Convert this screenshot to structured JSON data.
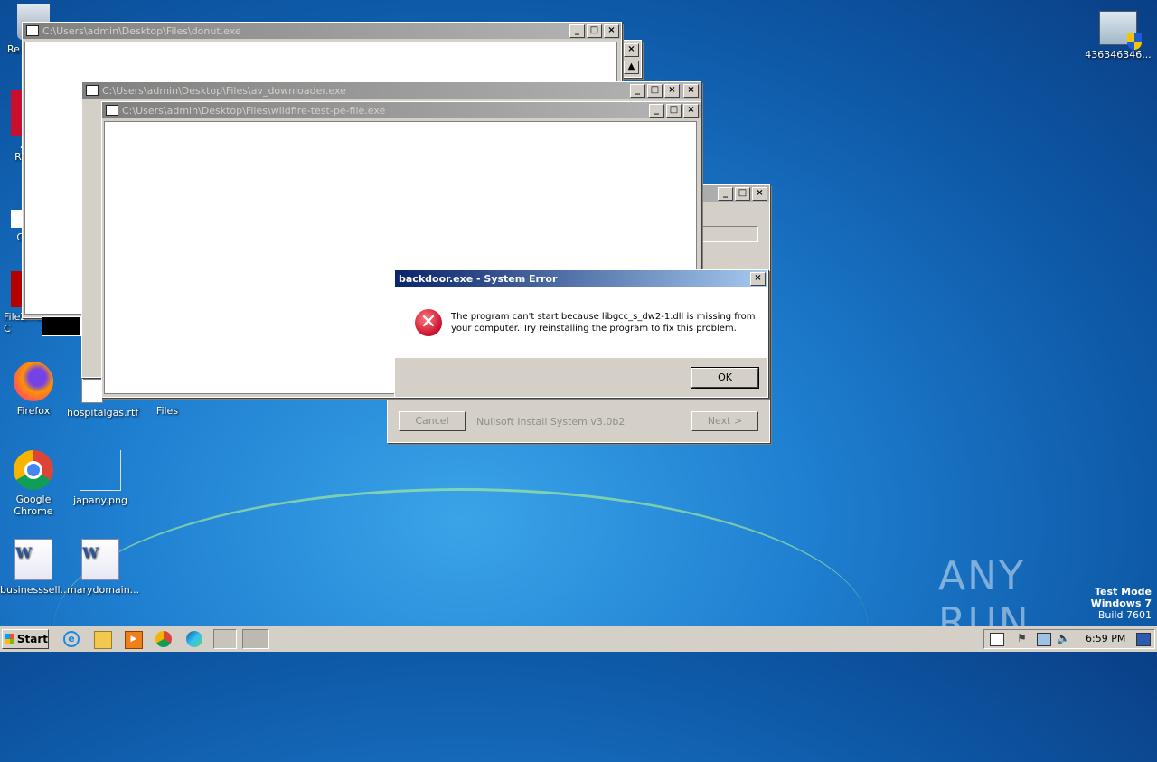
{
  "desktop": {
    "icons": [
      {
        "label": "Re",
        "key": "recycle"
      },
      {
        "label": "A\nRe",
        "key": "acrobat"
      },
      {
        "label": "C",
        "key": "c"
      },
      {
        "label": "FileZilla C",
        "key": "filezilla"
      },
      {
        "label": "Firefox",
        "key": "firefox"
      },
      {
        "label": "hospitalgas.rtf",
        "key": "rtf"
      },
      {
        "label": "Files",
        "key": "files"
      },
      {
        "label": "Google Chrome",
        "key": "chrome"
      },
      {
        "label": "japany.png",
        "key": "png"
      },
      {
        "label": "businesssell...",
        "key": "word1"
      },
      {
        "label": "marydomain...",
        "key": "word2"
      },
      {
        "label": "436346346...",
        "key": "shield"
      }
    ],
    "watermark": {
      "brand": "ANY RUN"
    },
    "test_mode": {
      "line1": "Test Mode",
      "line2": "Windows 7",
      "line3": "Build 7601"
    }
  },
  "windows": {
    "donut": {
      "title": "C:\\Users\\admin\\Desktop\\Files\\donut.exe"
    },
    "av": {
      "title": "C:\\Users\\admin\\Desktop\\Files\\av_downloader.exe"
    },
    "wildfire": {
      "title": "C:\\Users\\admin\\Desktop\\Files\\wildfire-test-pe-file.exe"
    },
    "nsis": {
      "cancel": "Cancel",
      "brand": "Nullsoft Install System v3.0b2",
      "next": "Next >"
    },
    "buttons": {
      "minimize": "_",
      "maximize": "□",
      "close": "×"
    }
  },
  "error_dialog": {
    "title": "backdoor.exe - System Error",
    "message_line1": "The program can't start because libgcc_s_dw2-1.dll is missing from",
    "message_line2": "your computer. Try reinstalling the program to fix this problem.",
    "ok": "OK",
    "icon": "error-icon"
  },
  "taskbar": {
    "start": "Start",
    "clock": "6:59 PM",
    "icons": [
      "ie-icon",
      "explorer-icon",
      "media-player-icon",
      "chrome-icon",
      "edge-icon",
      "cmd-icon",
      "window-icon"
    ]
  },
  "colors": {
    "title_active": "#0a246a",
    "error_red": "#c8102e",
    "desktop": "#1f7fd1"
  }
}
